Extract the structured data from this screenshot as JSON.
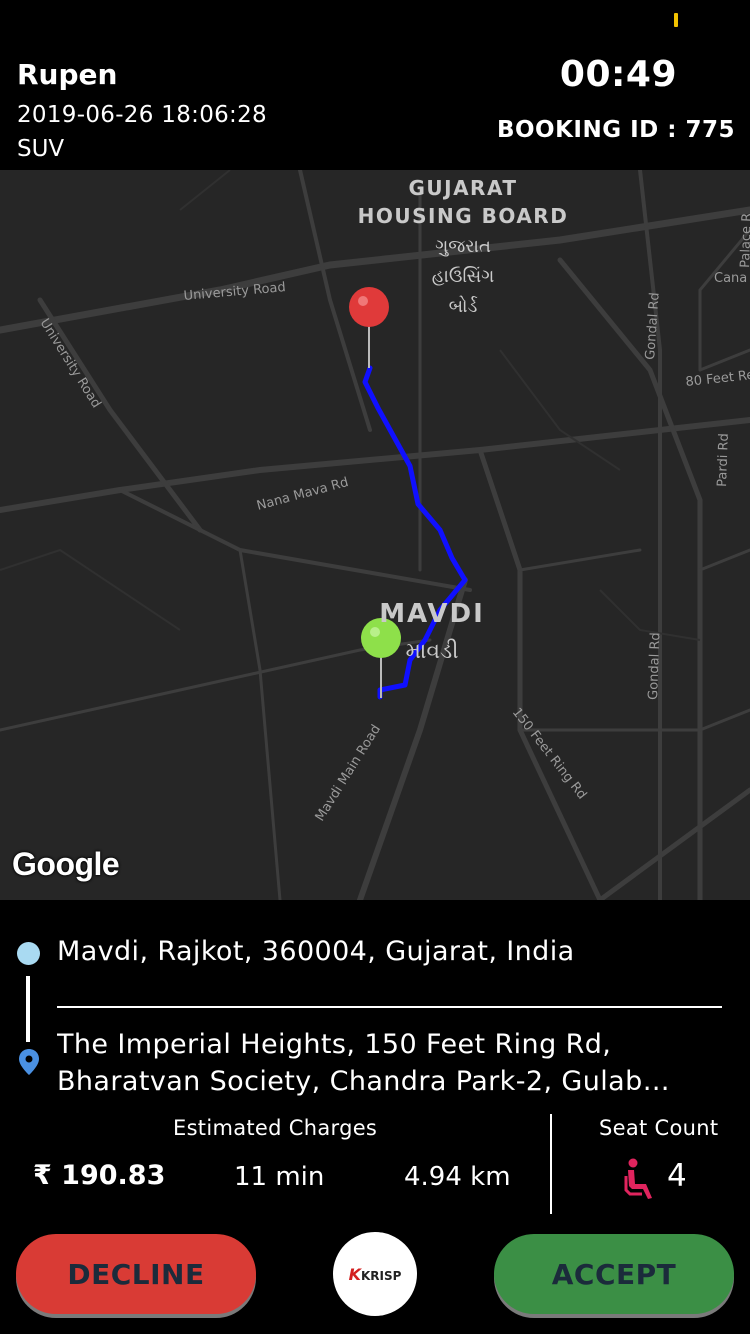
{
  "header": {
    "rider_name": "Rupen",
    "request_datetime": "2019-06-26 18:06:28",
    "vehicle_type": "SUV",
    "countdown": "00:49",
    "booking_id": "BOOKING ID : 775"
  },
  "map": {
    "attribution": "Google",
    "labels": {
      "area_1_en_line1": "GUJARAT",
      "area_1_en_line2": "HOUSING BOARD",
      "area_1_local_line1": "ગુજરાત",
      "area_1_local_line2": "હાઉસિંગ",
      "area_1_local_line3": "બોર્ડ",
      "area_2_en": "MAVDI",
      "area_2_local": "માવડી",
      "road_university_1": "University Road",
      "road_university_2": "University Road",
      "road_nana_mava": "Nana Mava Rd",
      "road_gondal_1": "Gondal Rd",
      "road_gondal_2": "Gondal Rd",
      "road_80_feet": "80 Feet Re",
      "road_pardi": "Pardi Rd",
      "road_150_feet": "150 Feet Ring Rd",
      "road_mavdi_main": "Mavdi Main Road",
      "road_palace": "Palace R",
      "road_cana": "Cana"
    },
    "route_color": "#1010ff",
    "pickup_pin_color": "#e03a3a",
    "drop_pin_color": "#8ee04a"
  },
  "trip": {
    "pickup_address": "Mavdi, Rajkot, 360004, Gujarat, India",
    "drop_address_line1": "The Imperial Heights, 150 Feet Ring Rd,",
    "drop_address_line2": "Bharatvan Society, Chandra Park-2, Gulab…",
    "pickup_dot_color": "#a9daf2",
    "drop_pin_color": "#4a90e2"
  },
  "charges": {
    "label": "Estimated Charges",
    "fare": "₹ 190.83",
    "duration": "11 min",
    "distance": "4.94 km"
  },
  "seats": {
    "label": "Seat Count",
    "count": "4",
    "icon": "seat-icon",
    "icon_color": "#e0245e"
  },
  "actions": {
    "decline_label": "DECLINE",
    "accept_label": "ACCEPT",
    "decline_color": "#d93b35",
    "accept_color": "#3b8f45"
  },
  "brand": {
    "logo_text": "KRISP"
  }
}
